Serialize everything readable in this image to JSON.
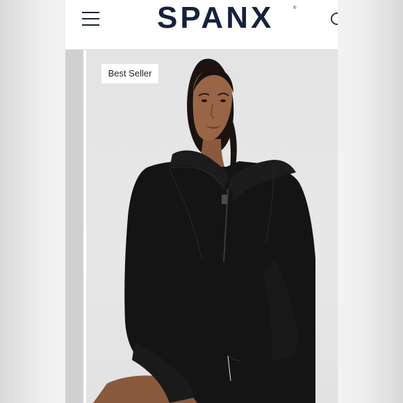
{
  "header": {
    "brand_logo_text": "SPANX",
    "brand_mark": "®",
    "menu_icon": "hamburger-menu-icon",
    "search_icon": "search-icon"
  },
  "product": {
    "badge_label": "Best Seller"
  },
  "colors": {
    "brand_navy": "#16213b",
    "sweater_black": "#141414",
    "photo_background": "#e6e6e7"
  }
}
